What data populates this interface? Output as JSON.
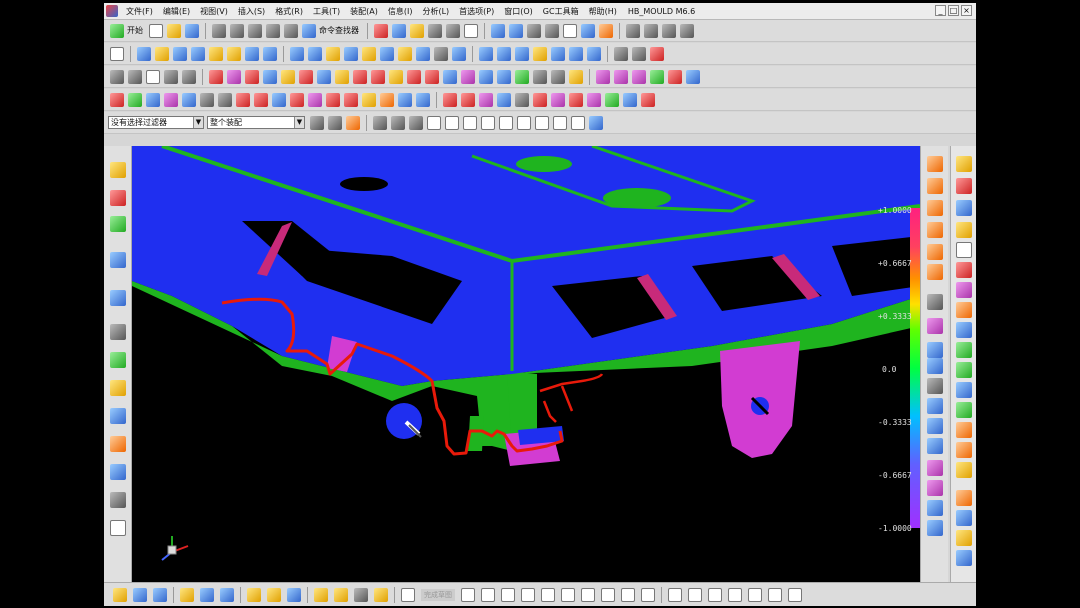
{
  "menubar": {
    "items": [
      "文件(F)",
      "编辑(E)",
      "视图(V)",
      "插入(S)",
      "格式(R)",
      "工具(T)",
      "装配(A)",
      "信息(I)",
      "分析(L)",
      "首选项(P)",
      "窗口(O)",
      "GC工具箱",
      "帮助(H)"
    ],
    "title": "HB_MOULD M6.6",
    "window_buttons": [
      "_",
      "□",
      "×"
    ]
  },
  "toolbar": {
    "start_label": "开始",
    "command_finder_label": "命令查找器"
  },
  "selection_bar": {
    "filter_value": "没有选择过滤器",
    "scope_value": "整个装配"
  },
  "legend": {
    "ticks": [
      "+1.0000",
      "+0.6667",
      "+0.3333",
      "0.0",
      "-0.3333",
      "-0.6667",
      "-1.0000"
    ]
  },
  "bottombar": {
    "sketch_label": "完成草图"
  },
  "icons": {
    "start": "start-icon",
    "command_finder": "command-finder-icon",
    "cursor": "pen-cursor-icon",
    "axis_triad": "axis-triad-icon"
  },
  "colors": {
    "model_blue": "#1f2ff0",
    "model_green": "#1fb41f",
    "model_magenta": "#d23cd2",
    "trace_red": "#e81a0a",
    "viewport_bg": "#000000"
  }
}
